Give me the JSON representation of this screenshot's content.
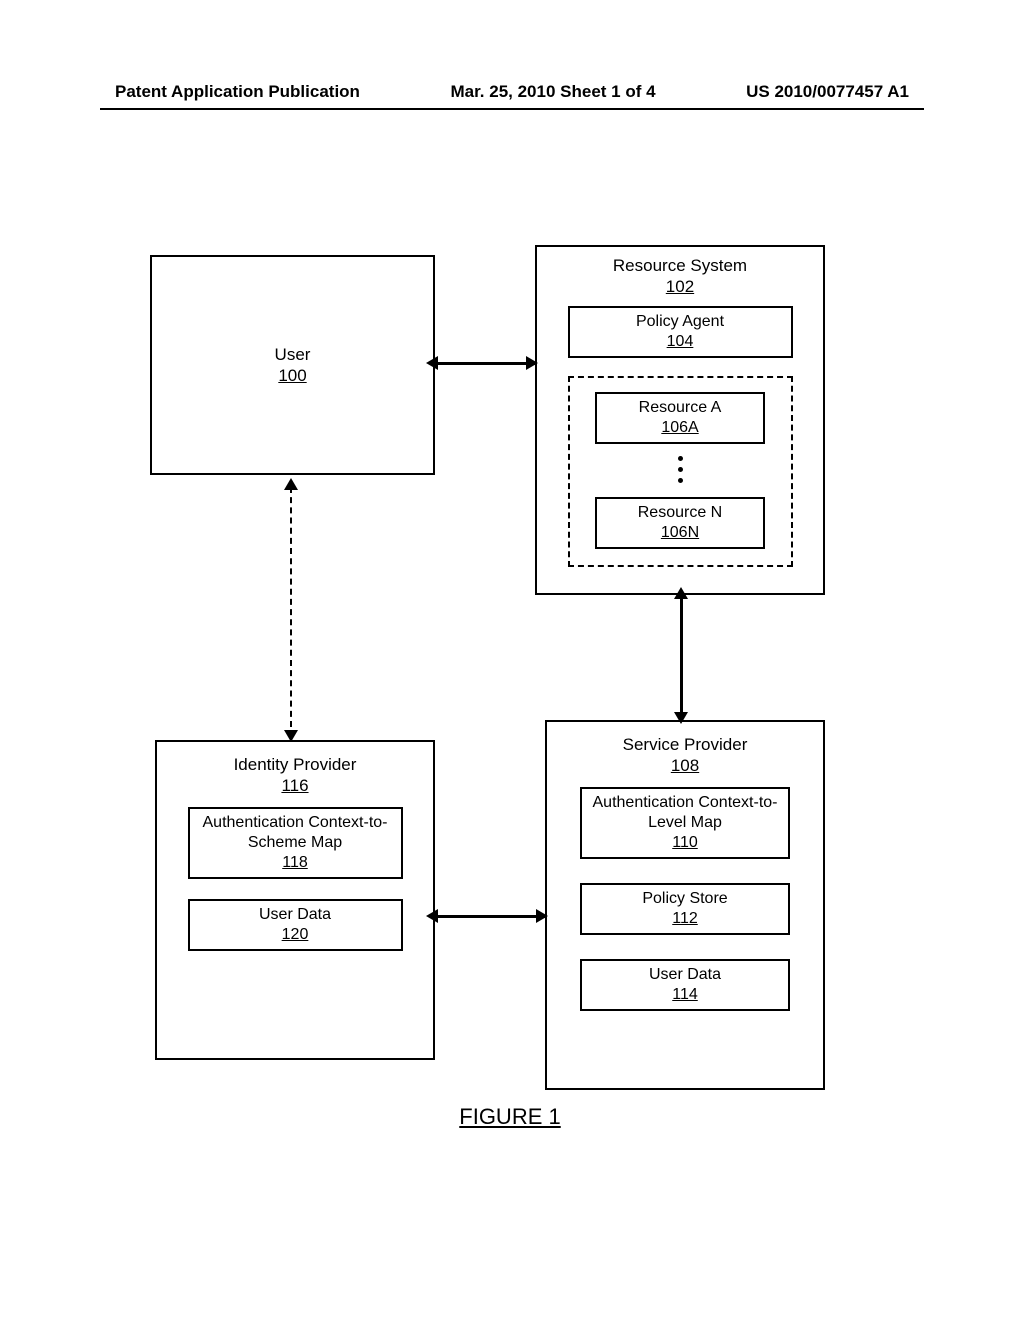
{
  "header": {
    "left": "Patent Application Publication",
    "center": "Mar. 25, 2010  Sheet 1 of 4",
    "right": "US 2010/0077457 A1"
  },
  "figure": {
    "caption": "FIGURE 1",
    "user": {
      "name": "User",
      "ref": "100"
    },
    "resource_system": {
      "name": "Resource System",
      "ref": "102",
      "policy_agent": {
        "name": "Policy Agent",
        "ref": "104"
      },
      "resources": [
        {
          "name": "Resource A",
          "ref": "106A"
        },
        {
          "name": "Resource N",
          "ref": "106N"
        }
      ]
    },
    "identity_provider": {
      "name": "Identity Provider",
      "ref": "116",
      "auth_map": {
        "name": "Authentication Context-to-Scheme Map",
        "ref": "118"
      },
      "user_data": {
        "name": "User Data",
        "ref": "120"
      }
    },
    "service_provider": {
      "name": "Service Provider",
      "ref": "108",
      "auth_map": {
        "name": "Authentication Context-to-Level Map",
        "ref": "110"
      },
      "policy_store": {
        "name": "Policy Store",
        "ref": "112"
      },
      "user_data": {
        "name": "User Data",
        "ref": "114"
      }
    }
  }
}
